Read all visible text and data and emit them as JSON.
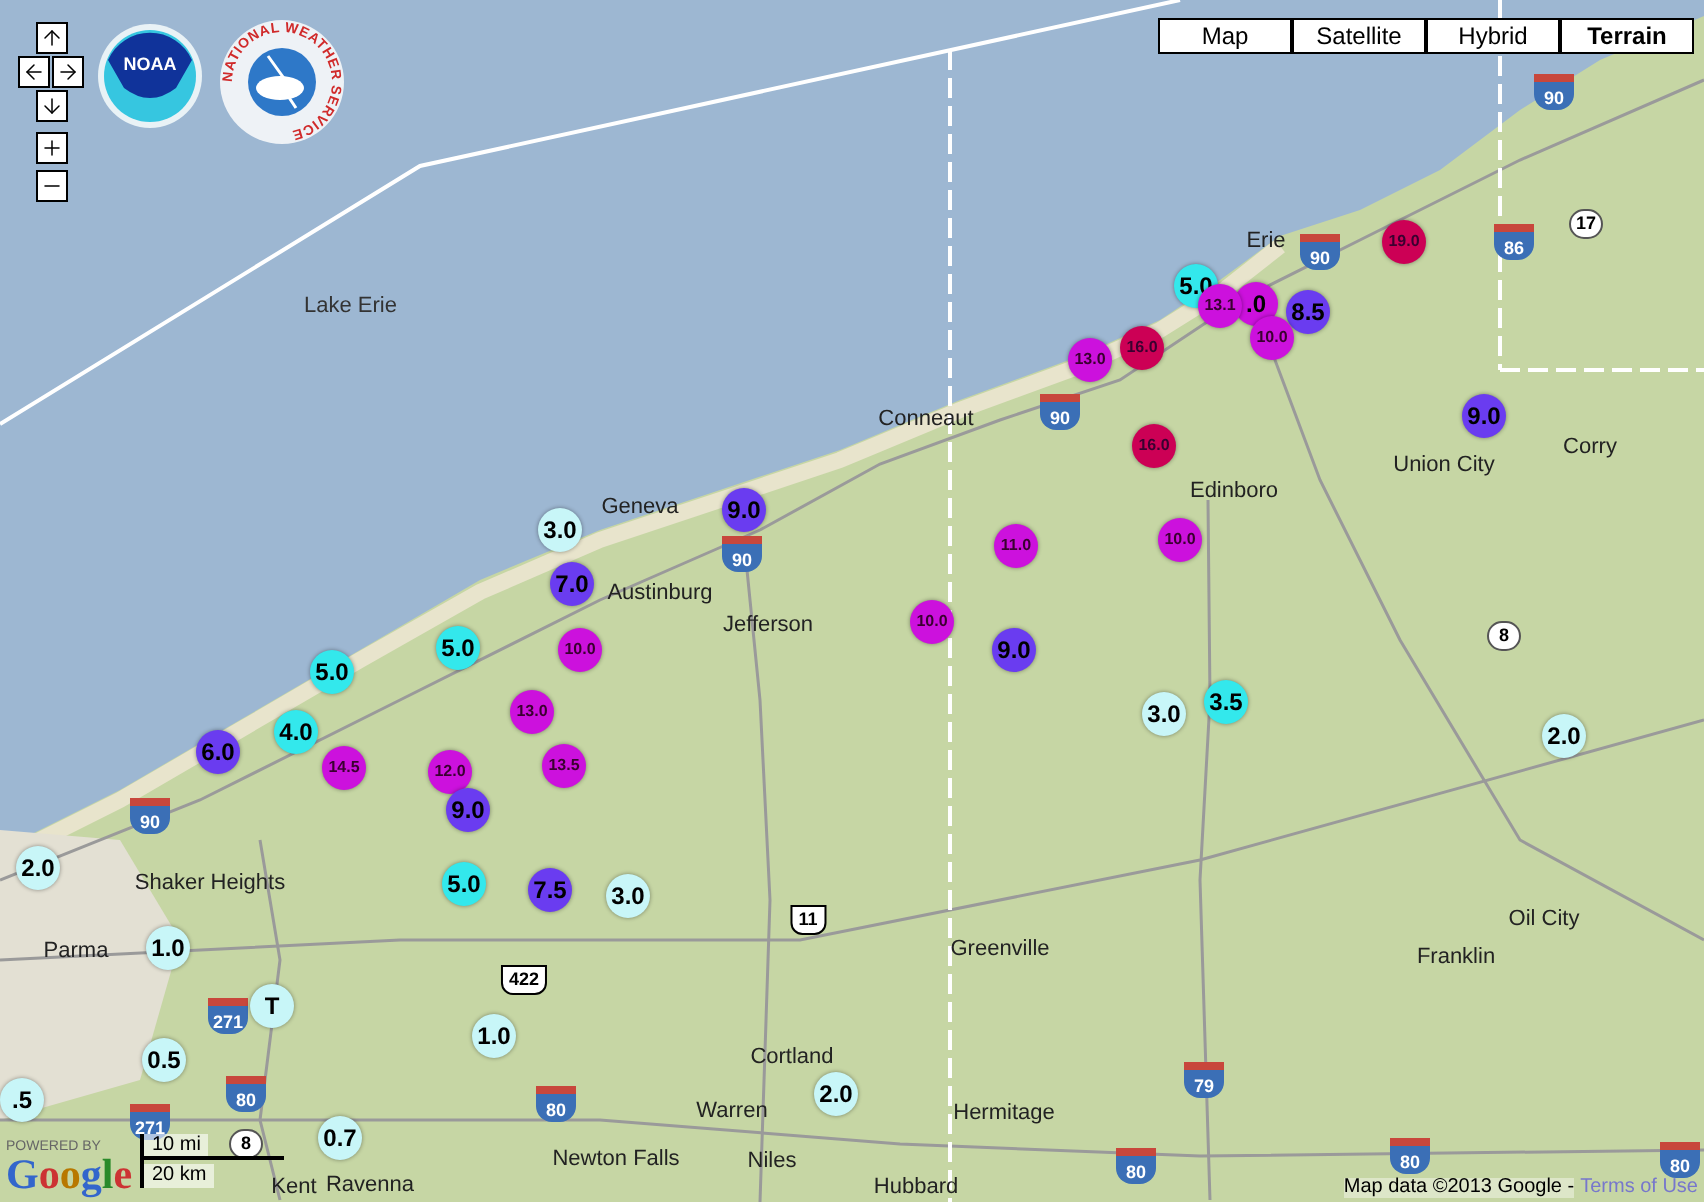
{
  "map_type_buttons": [
    {
      "label": "Map",
      "selected": false
    },
    {
      "label": "Satellite",
      "selected": false
    },
    {
      "label": "Hybrid",
      "selected": false
    },
    {
      "label": "Terrain",
      "selected": true
    }
  ],
  "logos": {
    "noaa": "NOAA",
    "nws": "NATIONAL WEATHER SERVICE"
  },
  "water_label": "Lake Erie",
  "places": [
    "Erie",
    "Conneaut",
    "Union City",
    "Corry",
    "Edinboro",
    "Geneva",
    "Austinburg",
    "Jefferson",
    "Shaker Heights",
    "Parma",
    "Greenville",
    "Oil City",
    "Franklin",
    "Cortland",
    "Warren",
    "Newton Falls",
    "Niles",
    "Hermitage",
    "Kent",
    "Ravenna",
    "Hubbard"
  ],
  "route_shields": [
    {
      "label": "90",
      "kind": "interstate"
    },
    {
      "label": "86",
      "kind": "interstate"
    },
    {
      "label": "17",
      "kind": "state"
    },
    {
      "label": "90",
      "kind": "interstate"
    },
    {
      "label": "90",
      "kind": "interstate"
    },
    {
      "label": "90",
      "kind": "interstate"
    },
    {
      "label": "90",
      "kind": "interstate"
    },
    {
      "label": "8",
      "kind": "state"
    },
    {
      "label": "11",
      "kind": "us"
    },
    {
      "label": "422",
      "kind": "us"
    },
    {
      "label": "271",
      "kind": "interstate"
    },
    {
      "label": "80",
      "kind": "interstate"
    },
    {
      "label": "271",
      "kind": "interstate"
    },
    {
      "label": "80",
      "kind": "interstate"
    },
    {
      "label": "79",
      "kind": "interstate"
    },
    {
      "label": "80",
      "kind": "interstate"
    },
    {
      "label": "80",
      "kind": "interstate"
    },
    {
      "label": "80",
      "kind": "interstate"
    },
    {
      "label": "8",
      "kind": "state"
    }
  ],
  "markers": [
    {
      "value": "19.0",
      "color": "#cc0055"
    },
    {
      "value": "5.0",
      "color": "#33e8ec"
    },
    {
      "value": "13.1",
      "color": "#cc11dd"
    },
    {
      "value": ".0",
      "color": "#cc11dd"
    },
    {
      "value": "8.5",
      "color": "#6a3cf0"
    },
    {
      "value": "10.0",
      "color": "#cc11dd"
    },
    {
      "value": "16.0",
      "color": "#cc0055"
    },
    {
      "value": "13.0",
      "color": "#cc11dd"
    },
    {
      "value": "16.0",
      "color": "#cc0055"
    },
    {
      "value": "9.0",
      "color": "#6a3cf0"
    },
    {
      "value": "9.0",
      "color": "#6a3cf0"
    },
    {
      "value": "3.0",
      "color": "#c8f6f8"
    },
    {
      "value": "11.0",
      "color": "#cc11dd"
    },
    {
      "value": "10.0",
      "color": "#cc11dd"
    },
    {
      "value": "7.0",
      "color": "#6a3cf0"
    },
    {
      "value": "10.0",
      "color": "#cc11dd"
    },
    {
      "value": "9.0",
      "color": "#6a3cf0"
    },
    {
      "value": "5.0",
      "color": "#33e8ec"
    },
    {
      "value": "5.0",
      "color": "#33e8ec"
    },
    {
      "value": "10.0",
      "color": "#cc11dd"
    },
    {
      "value": "13.0",
      "color": "#cc11dd"
    },
    {
      "value": "3.0",
      "color": "#c8f6f8"
    },
    {
      "value": "3.5",
      "color": "#33e8ec"
    },
    {
      "value": "2.0",
      "color": "#c8f6f8"
    },
    {
      "value": "4.0",
      "color": "#33e8ec"
    },
    {
      "value": "6.0",
      "color": "#6a3cf0"
    },
    {
      "value": "14.5",
      "color": "#cc11dd"
    },
    {
      "value": "12.0",
      "color": "#cc11dd"
    },
    {
      "value": "13.5",
      "color": "#cc11dd"
    },
    {
      "value": "9.0",
      "color": "#6a3cf0"
    },
    {
      "value": "2.0",
      "color": "#c8f6f8"
    },
    {
      "value": "5.0",
      "color": "#33e8ec"
    },
    {
      "value": "7.5",
      "color": "#6a3cf0"
    },
    {
      "value": "3.0",
      "color": "#c8f6f8"
    },
    {
      "value": "1.0",
      "color": "#c8f6f8"
    },
    {
      "value": "T",
      "color": "#c8f6f8"
    },
    {
      "value": "1.0",
      "color": "#c8f6f8"
    },
    {
      "value": "0.5",
      "color": "#c8f6f8"
    },
    {
      "value": "2.0",
      "color": "#c8f6f8"
    },
    {
      "value": ".5",
      "color": "#c8f6f8"
    },
    {
      "value": "0.7",
      "color": "#c8f6f8"
    }
  ],
  "scale": {
    "miles": "10 mi",
    "kilometers": "20 km"
  },
  "powered_by": "POWERED BY",
  "google": "Google",
  "attribution": "Map data ©2013 Google -",
  "terms_link": "Terms of Use"
}
